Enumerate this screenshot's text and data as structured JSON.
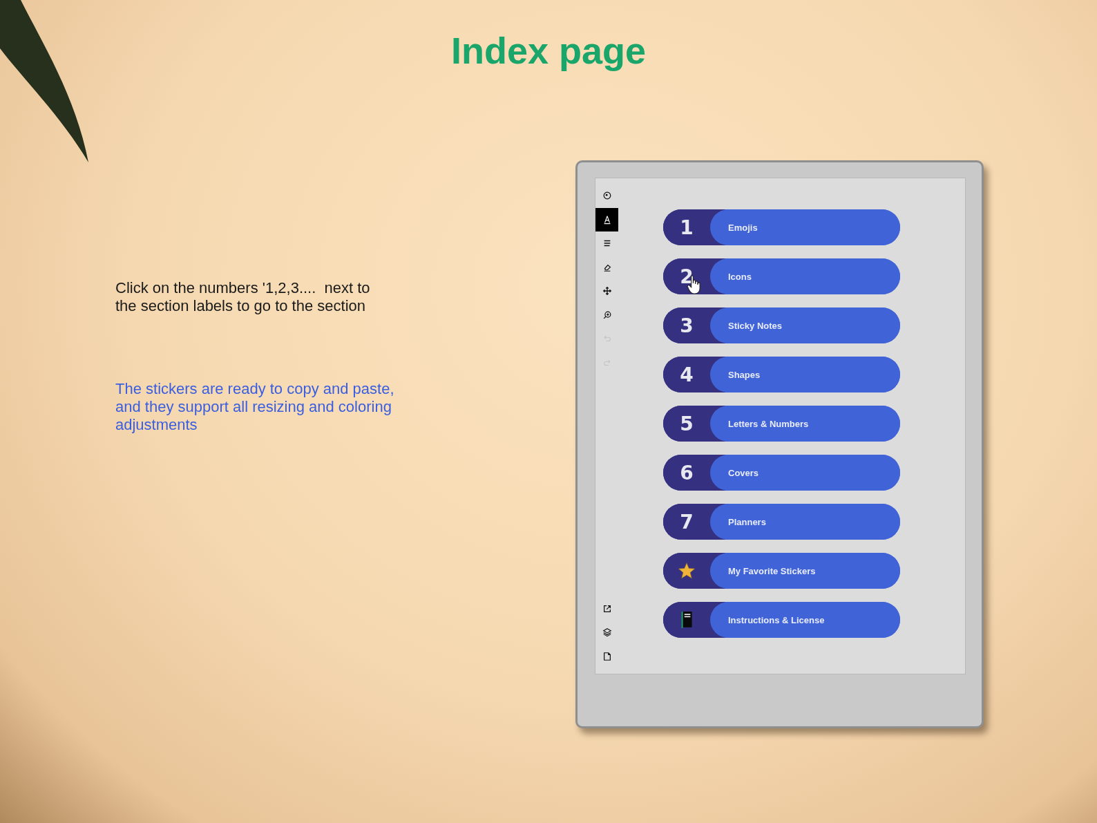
{
  "title": "Index page",
  "instructions": [
    {
      "kind": "plain",
      "text": "Click on the numbers '1,2,3....  next to the section labels to go to the section"
    },
    {
      "kind": "highlight",
      "text": "The stickers are ready to copy and paste, and they support all resizing and coloring adjustments"
    }
  ],
  "toolbar": {
    "top": [
      {
        "kind": "menu",
        "selected": false,
        "disabled": false
      },
      {
        "kind": "pen",
        "selected": true,
        "disabled": false
      },
      {
        "kind": "lines",
        "selected": false,
        "disabled": false
      },
      {
        "kind": "eraser",
        "selected": false,
        "disabled": false
      },
      {
        "kind": "move",
        "selected": false,
        "disabled": false
      },
      {
        "kind": "zoom",
        "selected": false,
        "disabled": false
      },
      {
        "kind": "undo",
        "selected": false,
        "disabled": true
      },
      {
        "kind": "redo",
        "selected": false,
        "disabled": true
      }
    ],
    "bottom": [
      {
        "kind": "share",
        "selected": false,
        "disabled": false
      },
      {
        "kind": "layers",
        "selected": false,
        "disabled": false
      },
      {
        "kind": "page",
        "selected": false,
        "disabled": false
      }
    ]
  },
  "sections": [
    {
      "kind": "number",
      "number": "1",
      "label": "Emojis"
    },
    {
      "kind": "number",
      "number": "2",
      "label": "Icons"
    },
    {
      "kind": "number",
      "number": "3",
      "label": "Sticky Notes"
    },
    {
      "kind": "number",
      "number": "4",
      "label": "Shapes"
    },
    {
      "kind": "number",
      "number": "5",
      "label": "Letters & Numbers"
    },
    {
      "kind": "number",
      "number": "6",
      "label": "Covers"
    },
    {
      "kind": "number",
      "number": "7",
      "label": "Planners"
    },
    {
      "kind": "star",
      "label": "My Favorite Stickers"
    },
    {
      "kind": "book",
      "label": "Instructions & License"
    }
  ]
}
